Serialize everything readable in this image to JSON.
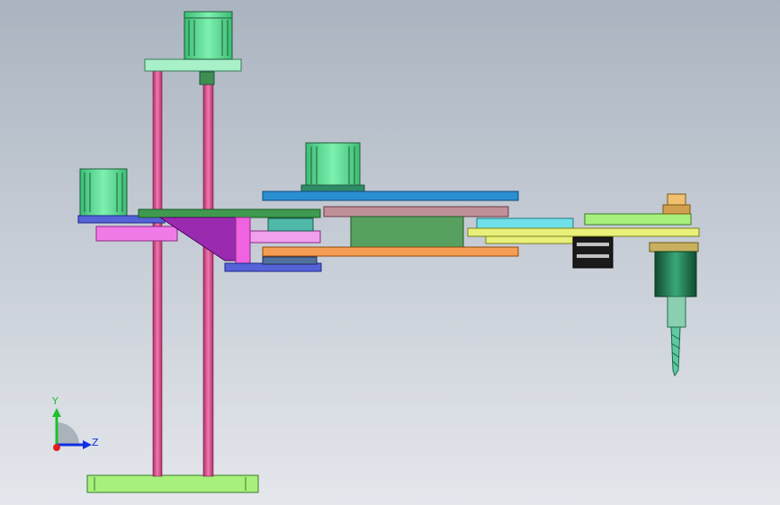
{
  "view": {
    "background_top": "#aeb8c4",
    "background_bottom": "#e2e5ea",
    "part_colors": {
      "motor_green": "#52d48a",
      "base_plate": "#a8f07c",
      "leadscrew": "#e05a95",
      "top_link": "#2a8fd0",
      "purple_bracket": "#9a2ab0",
      "magenta_plate": "#f07ae8",
      "orange_link": "#f59d52",
      "dark_green_block": "#57a060",
      "cyan_link": "#6fe0e8",
      "yellow_link": "#e8f07a",
      "spindle_dark": "#1f6f4a",
      "drill_bit": "#5fc8a0",
      "blue_plate": "#5562d8"
    }
  },
  "triad": {
    "y_label": "Y",
    "z_label": "Z",
    "y_color": "#20c030",
    "z_color": "#1030e0",
    "origin_color": "#e02020"
  }
}
